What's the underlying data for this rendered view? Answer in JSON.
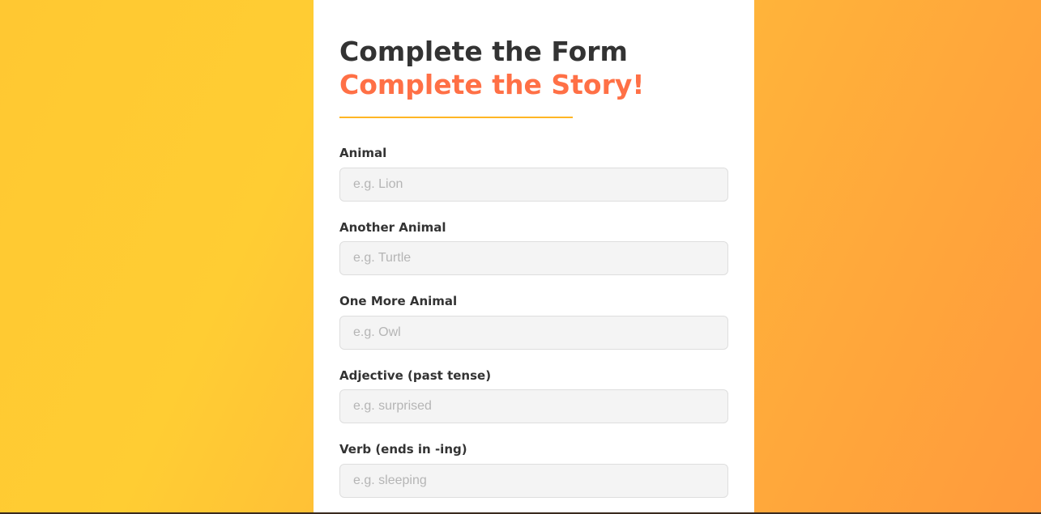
{
  "form": {
    "heading_line1": "Complete the Form",
    "heading_line2": "Complete the Story!",
    "fields": [
      {
        "label": "Animal",
        "placeholder": "e.g. Lion",
        "value": ""
      },
      {
        "label": "Another Animal",
        "placeholder": "e.g. Turtle",
        "value": ""
      },
      {
        "label": "One More Animal",
        "placeholder": "e.g. Owl",
        "value": ""
      },
      {
        "label": "Adjective (past tense)",
        "placeholder": "e.g. surprised",
        "value": ""
      },
      {
        "label": "Verb (ends in -ing)",
        "placeholder": "e.g. sleeping",
        "value": ""
      }
    ]
  },
  "colors": {
    "heading_primary": "#333333",
    "heading_accent": "#ff7046",
    "divider": "#ffb624",
    "background_gradient_start": "#ffc832",
    "background_gradient_end": "#ff9a3c",
    "input_background": "#f4f4f4"
  }
}
